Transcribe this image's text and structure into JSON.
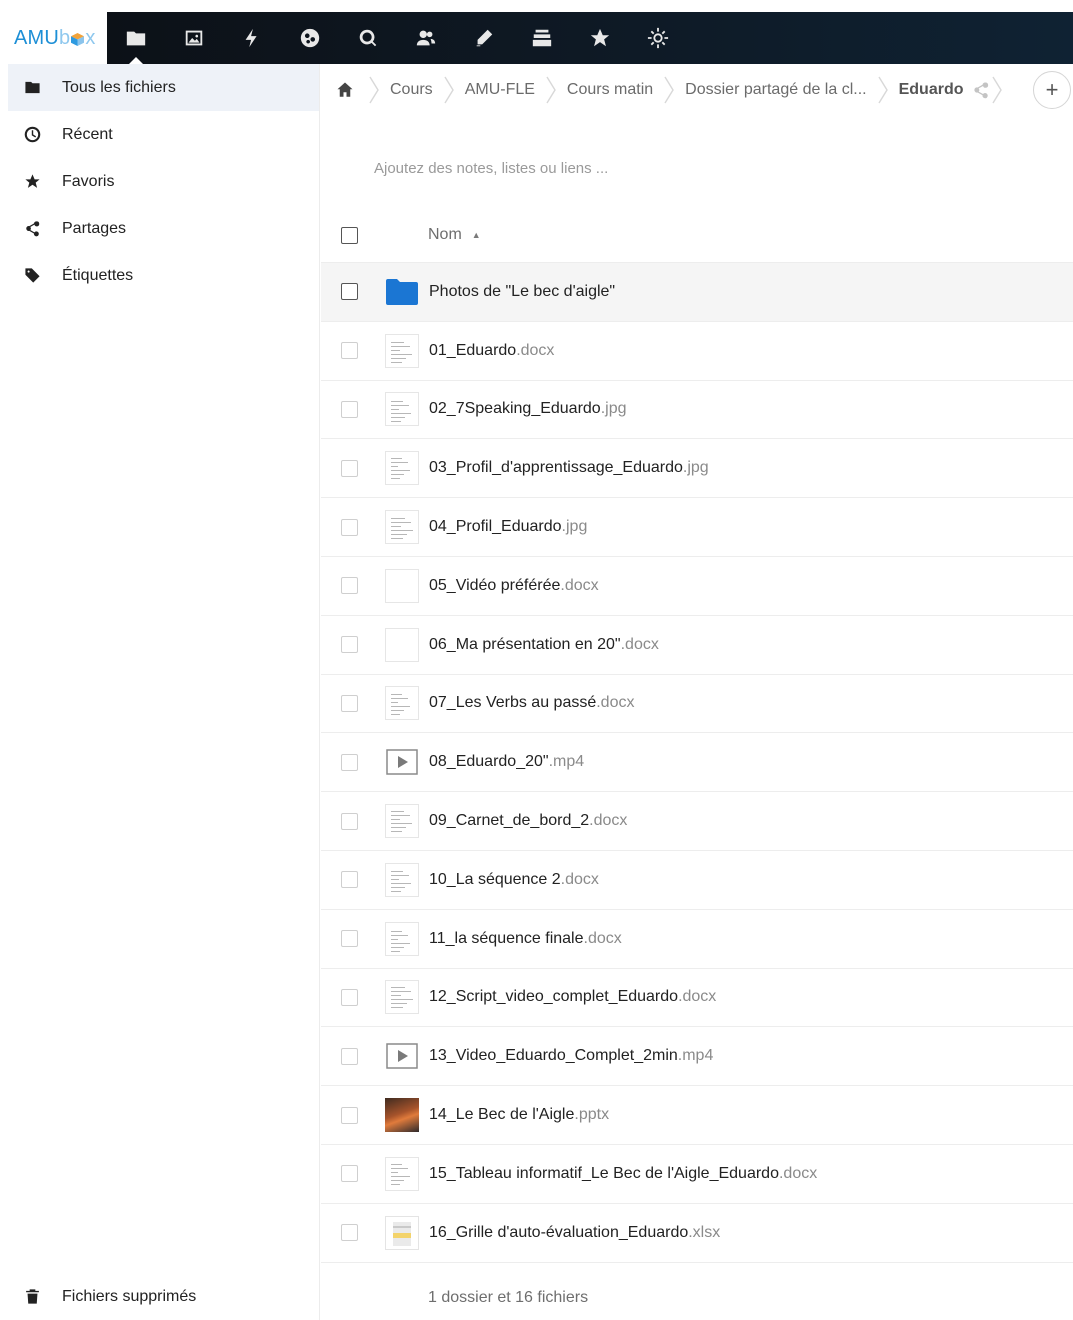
{
  "app": {
    "logo_amu": "AMU",
    "logo_b": "b",
    "logo_x": "x"
  },
  "top_nav": [
    {
      "name": "files-nav-icon",
      "icon": "folder"
    },
    {
      "name": "photos-nav-icon",
      "icon": "image"
    },
    {
      "name": "activity-nav-icon",
      "icon": "bolt"
    },
    {
      "name": "circle-app-nav-icon",
      "icon": "circle"
    },
    {
      "name": "search-nav-icon",
      "icon": "magnifier"
    },
    {
      "name": "contacts-nav-icon",
      "icon": "users"
    },
    {
      "name": "edit-nav-icon",
      "icon": "pencil"
    },
    {
      "name": "deck-nav-icon",
      "icon": "stack"
    },
    {
      "name": "favorites-nav-icon",
      "icon": "star"
    },
    {
      "name": "settings-nav-icon",
      "icon": "sun-gear"
    }
  ],
  "sidebar": {
    "items": [
      {
        "label": "Tous les fichiers",
        "icon": "folder-icon",
        "active": true
      },
      {
        "label": "Récent",
        "icon": "clock-icon"
      },
      {
        "label": "Favoris",
        "icon": "star-icon"
      },
      {
        "label": "Partages",
        "icon": "share-icon"
      },
      {
        "label": "Étiquettes",
        "icon": "tag-icon"
      }
    ],
    "trash_label": "Fichiers supprimés"
  },
  "breadcrumb": {
    "items": [
      "Cours",
      "AMU-FLE",
      "Cours matin",
      "Dossier partagé de la cl...",
      "Eduardo"
    ],
    "add_label": "+"
  },
  "notes_placeholder": "Ajoutez des notes, listes ou liens ...",
  "list": {
    "header_name": "Nom",
    "sort_indicator": "▲",
    "files": [
      {
        "name": "Photos de \"Le bec d'aigle\"",
        "ext": "",
        "type": "folder"
      },
      {
        "name": "01_Eduardo",
        "ext": ".docx",
        "type": "doc"
      },
      {
        "name": "02_7Speaking_Eduardo",
        "ext": ".jpg",
        "type": "doc"
      },
      {
        "name": "03_Profil_d'apprentissage_Eduardo",
        "ext": ".jpg",
        "type": "doc"
      },
      {
        "name": "04_Profil_Eduardo",
        "ext": ".jpg",
        "type": "doc"
      },
      {
        "name": "05_Vidéo préférée",
        "ext": ".docx",
        "type": "doc-blank"
      },
      {
        "name": "06_Ma présentation en 20\"",
        "ext": ".docx",
        "type": "doc-blank"
      },
      {
        "name": "07_Les Verbs au passé",
        "ext": ".docx",
        "type": "doc"
      },
      {
        "name": "08_Eduardo_20\"",
        "ext": ".mp4",
        "type": "video"
      },
      {
        "name": "09_Carnet_de_bord_2",
        "ext": ".docx",
        "type": "doc"
      },
      {
        "name": "10_La séquence 2",
        "ext": ".docx",
        "type": "doc"
      },
      {
        "name": "11_la séquence finale",
        "ext": ".docx",
        "type": "doc"
      },
      {
        "name": "12_Script_video_complet_Eduardo",
        "ext": ".docx",
        "type": "doc"
      },
      {
        "name": "13_Video_Eduardo_Complet_2min",
        "ext": ".mp4",
        "type": "video"
      },
      {
        "name": "14_Le Bec de l'Aigle",
        "ext": ".pptx",
        "type": "photo"
      },
      {
        "name": "15_Tableau informatif_Le Bec de l'Aigle_Eduardo",
        "ext": ".docx",
        "type": "doc"
      },
      {
        "name": "16_Grille d'auto-évaluation_Eduardo",
        "ext": ".xlsx",
        "type": "sheet"
      }
    ],
    "summary": "1 dossier et 16 fichiers"
  },
  "colors": {
    "accent": "#1b76d3",
    "header_bg": "#0e1a26",
    "active_sidebar_bg": "#eef2f8"
  }
}
